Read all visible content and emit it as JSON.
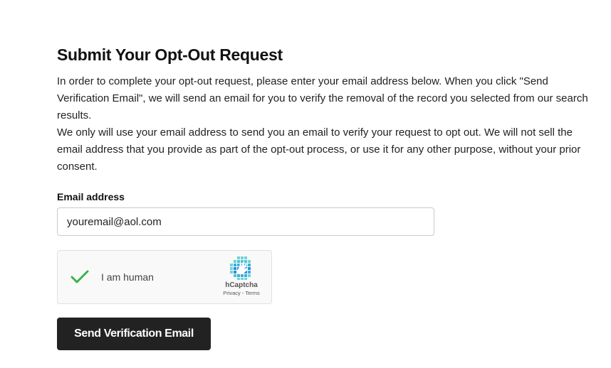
{
  "form": {
    "title": "Submit Your Opt-Out Request",
    "paragraphs": [
      "In order to complete your opt-out request, please enter your email address below. When you click \"Send Verification Email\", we will send an email for you to verify the removal of the record you selected from our search results.",
      "We only will use your email address to send you an email to verify your request to opt out. We will not sell the email address that you provide as part of the opt-out process, or use it for any other purpose, without your prior consent."
    ],
    "email_label": "Email address",
    "email_value": "youremail@aol.com",
    "submit_label": "Send Verification Email"
  },
  "captcha": {
    "status_icon": "checkmark-icon",
    "status_color": "#3cb34a",
    "text": "I am human",
    "brand": "hCaptcha",
    "links": "Privacy - Terms",
    "logo_icon": "hcaptcha-logo-icon"
  },
  "colors": {
    "button_bg": "#222222",
    "button_text": "#ffffff"
  }
}
